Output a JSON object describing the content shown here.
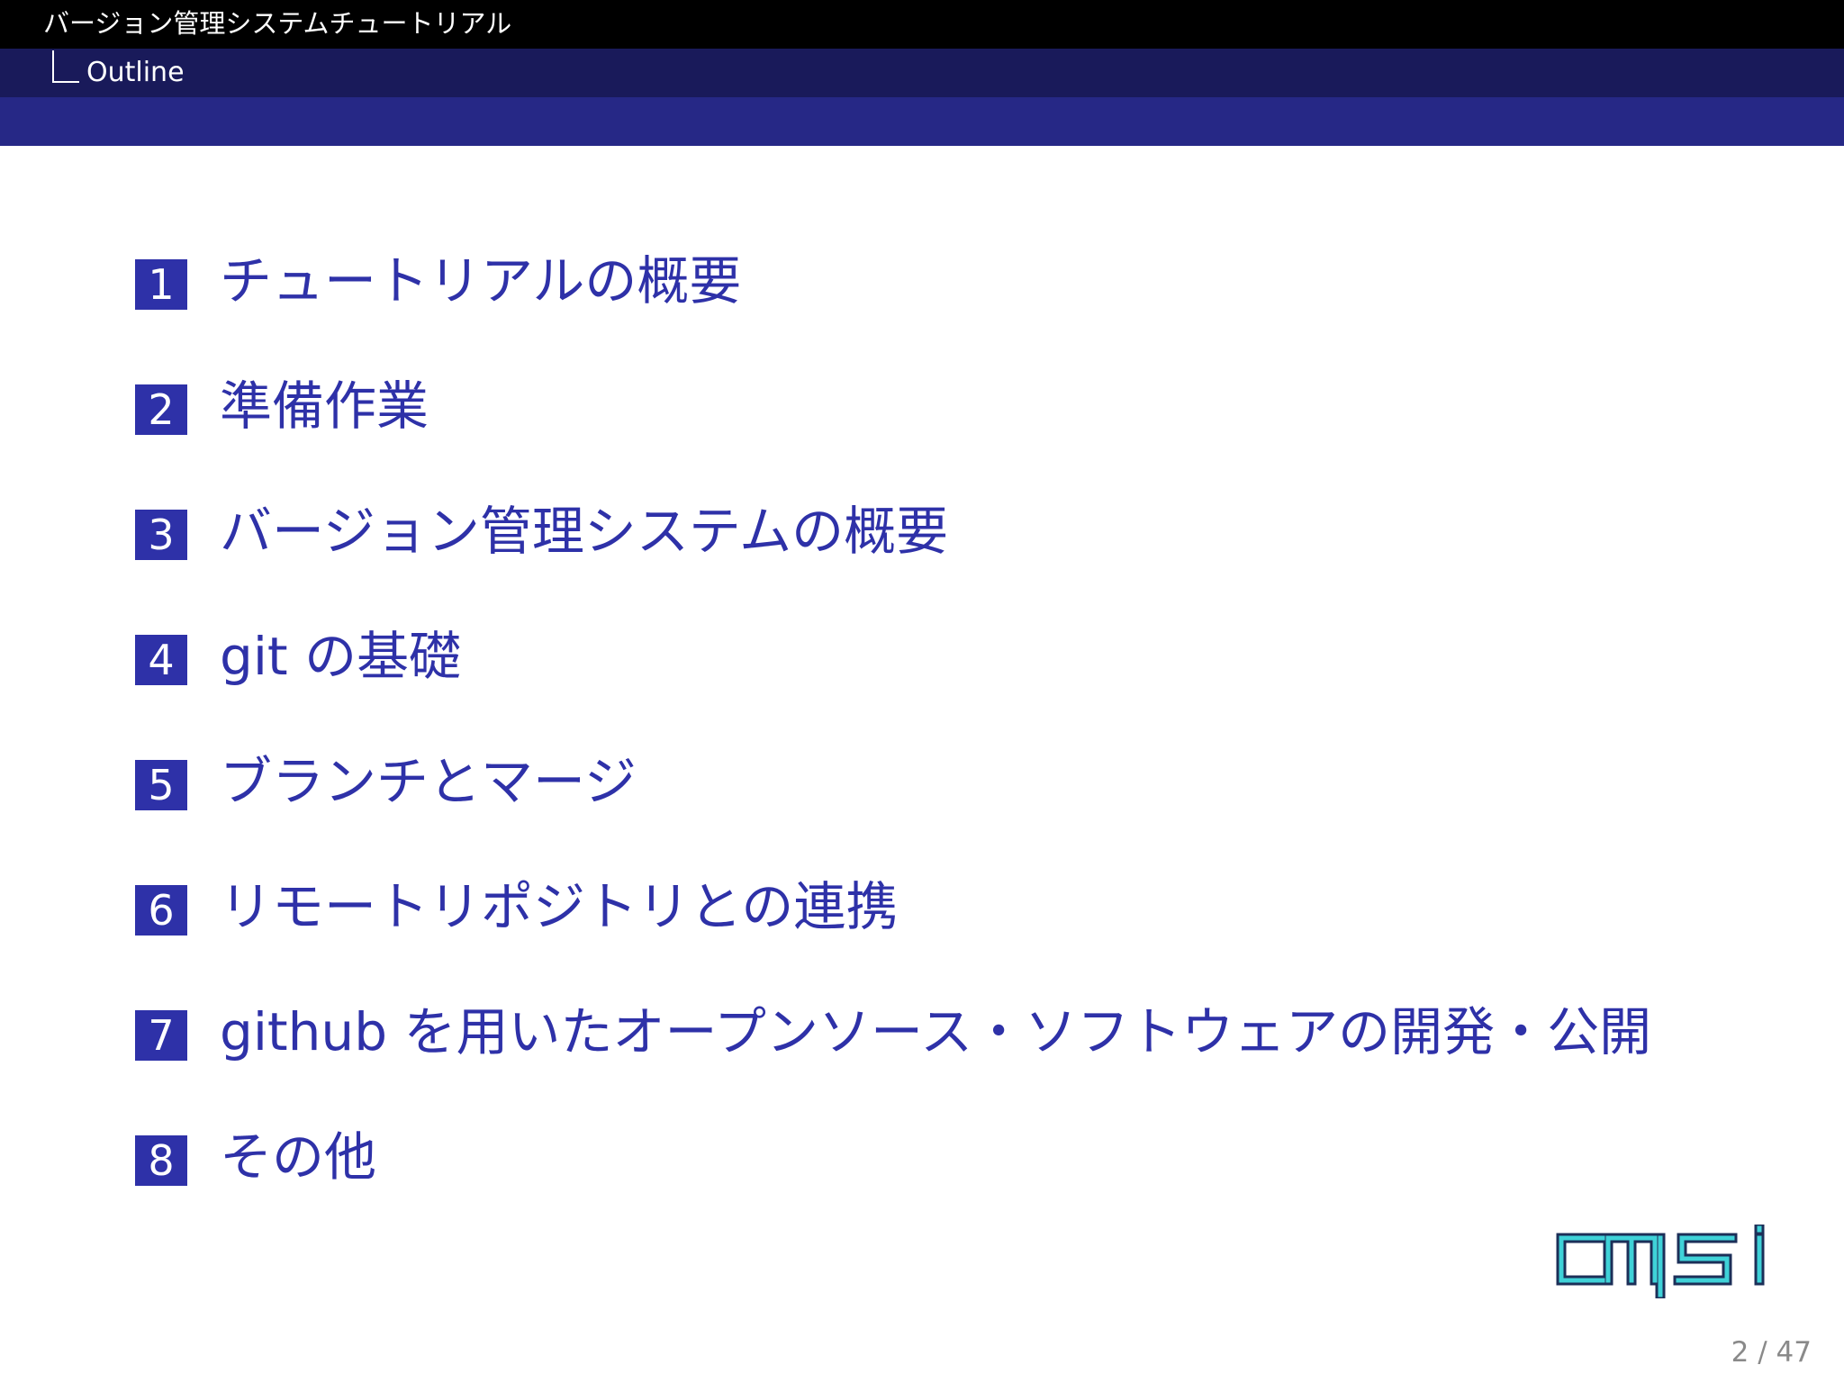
{
  "header": {
    "doc_title": "バージョン管理システムチュートリアル",
    "section_title": "Outline"
  },
  "outline": {
    "items": [
      {
        "number": "1",
        "label": "チュートリアルの概要"
      },
      {
        "number": "2",
        "label": "準備作業"
      },
      {
        "number": "3",
        "label": "バージョン管理システムの概要"
      },
      {
        "number": "4",
        "label": "git の基礎"
      },
      {
        "number": "5",
        "label": "ブランチとマージ"
      },
      {
        "number": "6",
        "label": "リモートリポジトリとの連携"
      },
      {
        "number": "7",
        "label": "github を用いたオープンソース・ソフトウェアの開発・公開"
      },
      {
        "number": "8",
        "label": "その他"
      }
    ]
  },
  "logo": {
    "text": "cmsi",
    "icon": "cmsi-logo"
  },
  "footer": {
    "page_number": "2 / 47"
  },
  "colors": {
    "header_top": "#000000",
    "header_mid": "#191a5a",
    "header_bottom": "#262886",
    "accent": "#2e31a8",
    "logo_stroke": "#1c2f58",
    "logo_fill": "#3fd2d8"
  }
}
